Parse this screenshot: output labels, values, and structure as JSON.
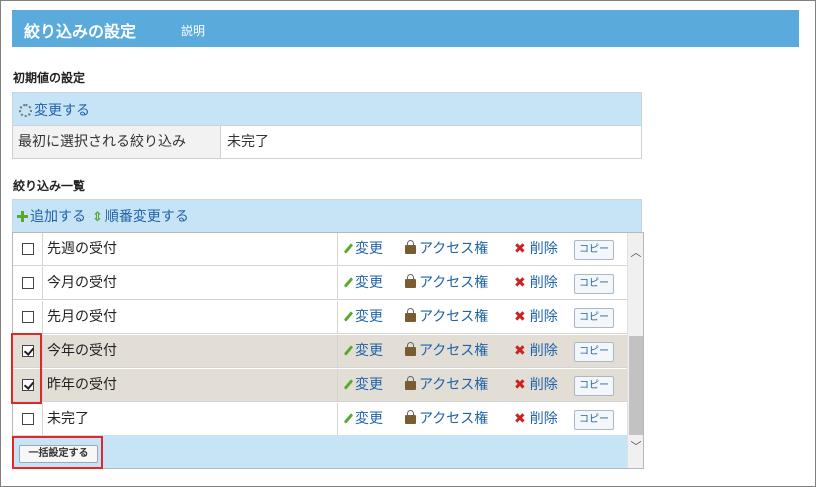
{
  "header": {
    "title": "絞り込みの設定",
    "help_link": "説明"
  },
  "initial": {
    "section_title": "初期値の設定",
    "change_link": "変更する",
    "label": "最初に選択される絞り込み",
    "value": "未完了"
  },
  "list": {
    "section_title": "絞り込み一覧",
    "add_link": "追加する",
    "reorder_link": "順番変更する",
    "actions": {
      "edit": "変更",
      "access": "アクセス権",
      "delete": "削除",
      "copy": "コピー"
    },
    "rows": [
      {
        "name": "先週の受付",
        "checked": false
      },
      {
        "name": "今月の受付",
        "checked": false
      },
      {
        "name": "先月の受付",
        "checked": false
      },
      {
        "name": "今年の受付",
        "checked": true
      },
      {
        "name": "昨年の受付",
        "checked": true
      },
      {
        "name": "未完了",
        "checked": false
      }
    ],
    "bulk_button": "一括設定する"
  },
  "colors": {
    "header_bg": "#5aabdc",
    "bar_bg": "#c7e3f6",
    "selected_row": "#e2ded6",
    "link": "#1f63a8",
    "highlight": "#e0282a"
  }
}
